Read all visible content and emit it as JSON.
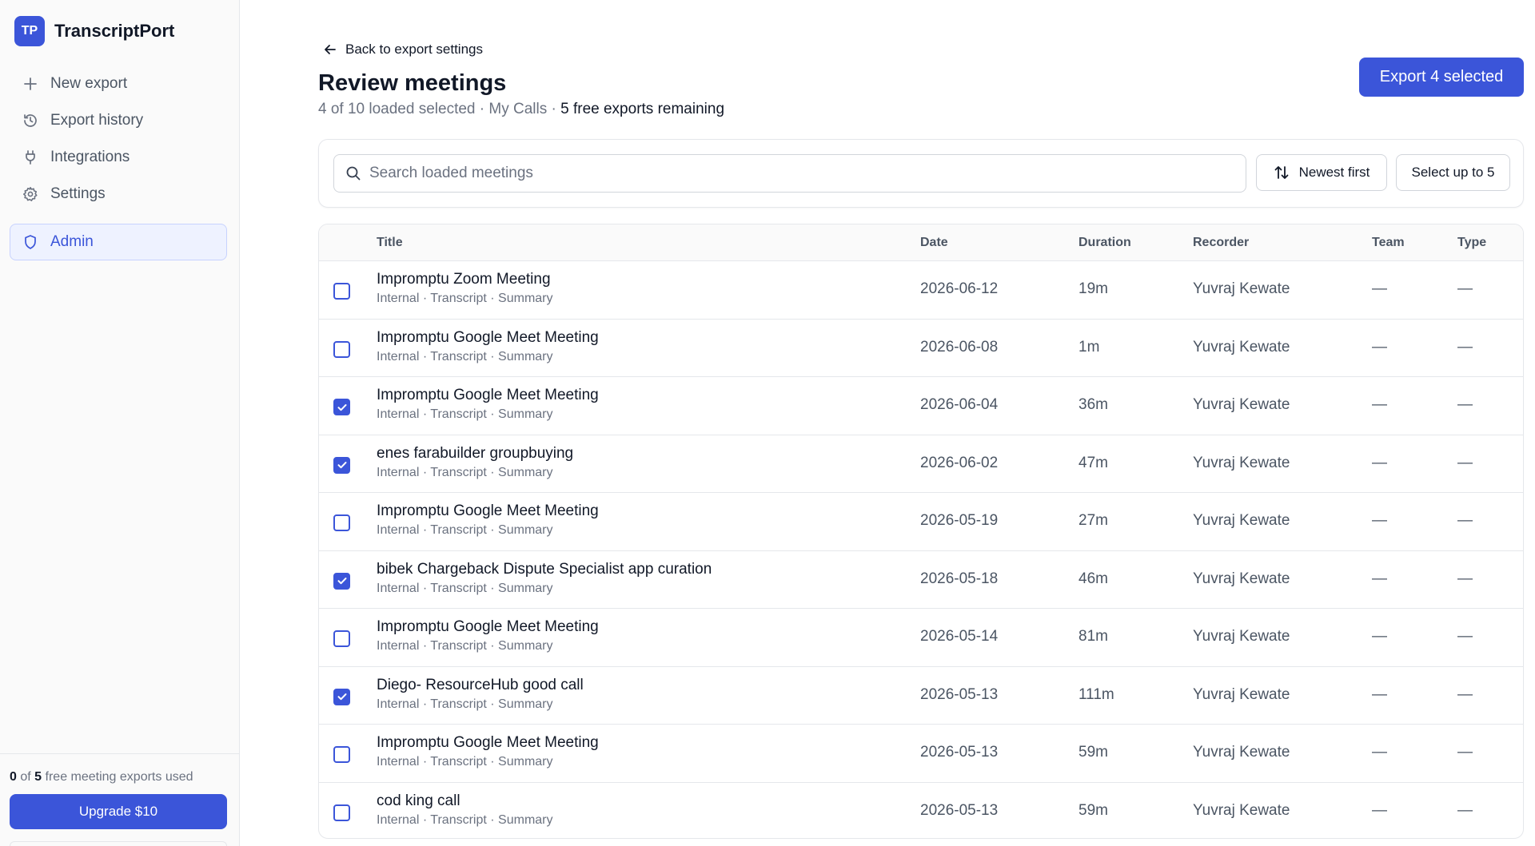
{
  "app": {
    "logo": "TP",
    "name": "TranscriptPort"
  },
  "sidebar": {
    "items": [
      {
        "label": "New export",
        "icon": "plus-icon"
      },
      {
        "label": "Export history",
        "icon": "history-icon"
      },
      {
        "label": "Integrations",
        "icon": "plug-icon"
      },
      {
        "label": "Settings",
        "icon": "gear-icon"
      },
      {
        "label": "Admin",
        "icon": "shield-icon",
        "active": true
      }
    ],
    "usage": {
      "used": "0",
      "of": "of",
      "total": "5",
      "text": "free meeting exports used"
    },
    "upgrade_label": "Upgrade $10"
  },
  "main": {
    "back_label": "Back to export settings",
    "title": "Review meetings",
    "subtitle_part1": "4 of 10 loaded selected",
    "sep1": "·",
    "subtitle_part2": "My Calls",
    "sep2": "·",
    "subtitle_part3": "5 free exports remaining",
    "export_button": "Export 4 selected",
    "search_placeholder": "Search loaded meetings",
    "sort_label": "Newest first",
    "select_label": "Select up to 5"
  },
  "table": {
    "headers": {
      "title": "Title",
      "date": "Date",
      "duration": "Duration",
      "recorder": "Recorder",
      "team": "Team",
      "type": "Type"
    },
    "rows": [
      {
        "checked": false,
        "title": "Impromptu Zoom Meeting",
        "meta": "Internal · Transcript · Summary",
        "date": "2026-06-12",
        "duration": "19m",
        "recorder": "Yuvraj Kewate",
        "team": "—",
        "type": "—"
      },
      {
        "checked": false,
        "title": "Impromptu Google Meet Meeting",
        "meta": "Internal · Transcript · Summary",
        "date": "2026-06-08",
        "duration": "1m",
        "recorder": "Yuvraj Kewate",
        "team": "—",
        "type": "—"
      },
      {
        "checked": true,
        "title": "Impromptu Google Meet Meeting",
        "meta": "Internal · Transcript · Summary",
        "date": "2026-06-04",
        "duration": "36m",
        "recorder": "Yuvraj Kewate",
        "team": "—",
        "type": "—"
      },
      {
        "checked": true,
        "title": "enes farabuilder groupbuying",
        "meta": "Internal · Transcript · Summary",
        "date": "2026-06-02",
        "duration": "47m",
        "recorder": "Yuvraj Kewate",
        "team": "—",
        "type": "—"
      },
      {
        "checked": false,
        "title": "Impromptu Google Meet Meeting",
        "meta": "Internal · Transcript · Summary",
        "date": "2026-05-19",
        "duration": "27m",
        "recorder": "Yuvraj Kewate",
        "team": "—",
        "type": "—"
      },
      {
        "checked": true,
        "title": "bibek Chargeback Dispute Specialist app curation",
        "meta": "Internal · Transcript · Summary",
        "date": "2026-05-18",
        "duration": "46m",
        "recorder": "Yuvraj Kewate",
        "team": "—",
        "type": "—"
      },
      {
        "checked": false,
        "title": "Impromptu Google Meet Meeting",
        "meta": "Internal · Transcript · Summary",
        "date": "2026-05-14",
        "duration": "81m",
        "recorder": "Yuvraj Kewate",
        "team": "—",
        "type": "—"
      },
      {
        "checked": true,
        "title": "Diego- ResourceHub good call",
        "meta": "Internal · Transcript · Summary",
        "date": "2026-05-13",
        "duration": "111m",
        "recorder": "Yuvraj Kewate",
        "team": "—",
        "type": "—"
      },
      {
        "checked": false,
        "title": "Impromptu Google Meet Meeting",
        "meta": "Internal · Transcript · Summary",
        "date": "2026-05-13",
        "duration": "59m",
        "recorder": "Yuvraj Kewate",
        "team": "—",
        "type": "—"
      },
      {
        "checked": false,
        "title": "cod king call",
        "meta": "Internal · Transcript · Summary",
        "date": "2026-05-13",
        "duration": "59m",
        "recorder": "Yuvraj Kewate",
        "team": "—",
        "type": "—"
      }
    ]
  },
  "colors": {
    "accent": "#3b55d9",
    "border": "#e5e7eb",
    "muted": "#6b7280"
  }
}
